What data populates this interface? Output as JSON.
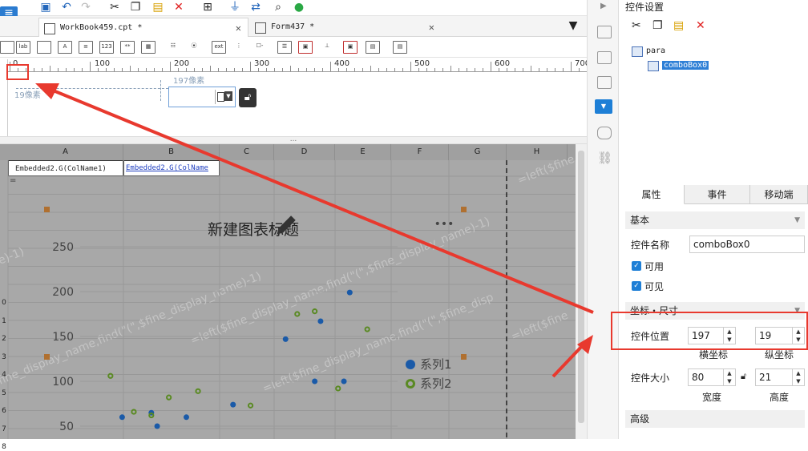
{
  "tabs": [
    {
      "label": "WorkBook459.cpt *"
    },
    {
      "label": "Form437 *"
    }
  ],
  "ruler": {
    "ticks": [
      "0",
      "100",
      "200",
      "300",
      "400",
      "500",
      "600",
      "700"
    ]
  },
  "form": {
    "x_px_label": "197像素",
    "y_px_label": "19像素"
  },
  "grid": {
    "columns": [
      "A",
      "B",
      "C",
      "D",
      "E",
      "F",
      "G",
      "H"
    ],
    "row_labels": [
      "0",
      "1",
      "2",
      "3",
      "4",
      "5",
      "6",
      "7",
      "8"
    ],
    "cell_a1": "Embedded2.G(ColName1)",
    "cell_b1": "Embedded2.G(ColName",
    "cell_a2": "=",
    "watermarks": [
      "=left($fine_d",
      "=left($fine_display_name,find(\"(\",$fine_display_name)-1)",
      "e)-1)",
      "fine_display_name,find(\"(\",$fine_display_name)-1)",
      "=left($fine_display_name,find(\"(\",$fine_disp",
      "=left($fine"
    ],
    "chart_menu": "•••"
  },
  "chart_data": {
    "type": "scatter",
    "title": "新建图表标题",
    "xlabel": "",
    "ylabel": "",
    "ylim": [
      40,
      265
    ],
    "y_ticks": [
      50,
      100,
      150,
      200,
      250
    ],
    "legend_position": "right",
    "colors": {
      "series1": "#1a5aa8",
      "series2": "#5a8a23"
    },
    "series": [
      {
        "name": "系列1",
        "points": [
          [
            5,
            60
          ],
          [
            10,
            65
          ],
          [
            11,
            50
          ],
          [
            16,
            60
          ],
          [
            24,
            74
          ],
          [
            33,
            147
          ],
          [
            38,
            100
          ],
          [
            39,
            167
          ],
          [
            43,
            100
          ],
          [
            44,
            199
          ]
        ]
      },
      {
        "name": "系列2",
        "points": [
          [
            3,
            106
          ],
          [
            7,
            66
          ],
          [
            10,
            62
          ],
          [
            13,
            82
          ],
          [
            18,
            89
          ],
          [
            27,
            73
          ],
          [
            35,
            175
          ],
          [
            38,
            178
          ],
          [
            42,
            92
          ],
          [
            47,
            158
          ]
        ]
      }
    ]
  },
  "settings": {
    "title": "控件设置",
    "tree": {
      "root": "para",
      "child": "comboBox0"
    },
    "tabs": [
      "属性",
      "事件",
      "移动端"
    ],
    "section_basic": "基本",
    "name_label": "控件名称",
    "name_value": "comboBox0",
    "enabled_label": "可用",
    "visible_label": "可见",
    "section_coords": "坐标・尺寸",
    "position_label": "控件位置",
    "pos_x": "197",
    "pos_y": "19",
    "x_caption": "横坐标",
    "y_caption": "纵坐标",
    "size_label": "控件大小",
    "width": "80",
    "height": "21",
    "w_caption": "宽度",
    "h_caption": "高度",
    "section_advanced": "高级"
  }
}
